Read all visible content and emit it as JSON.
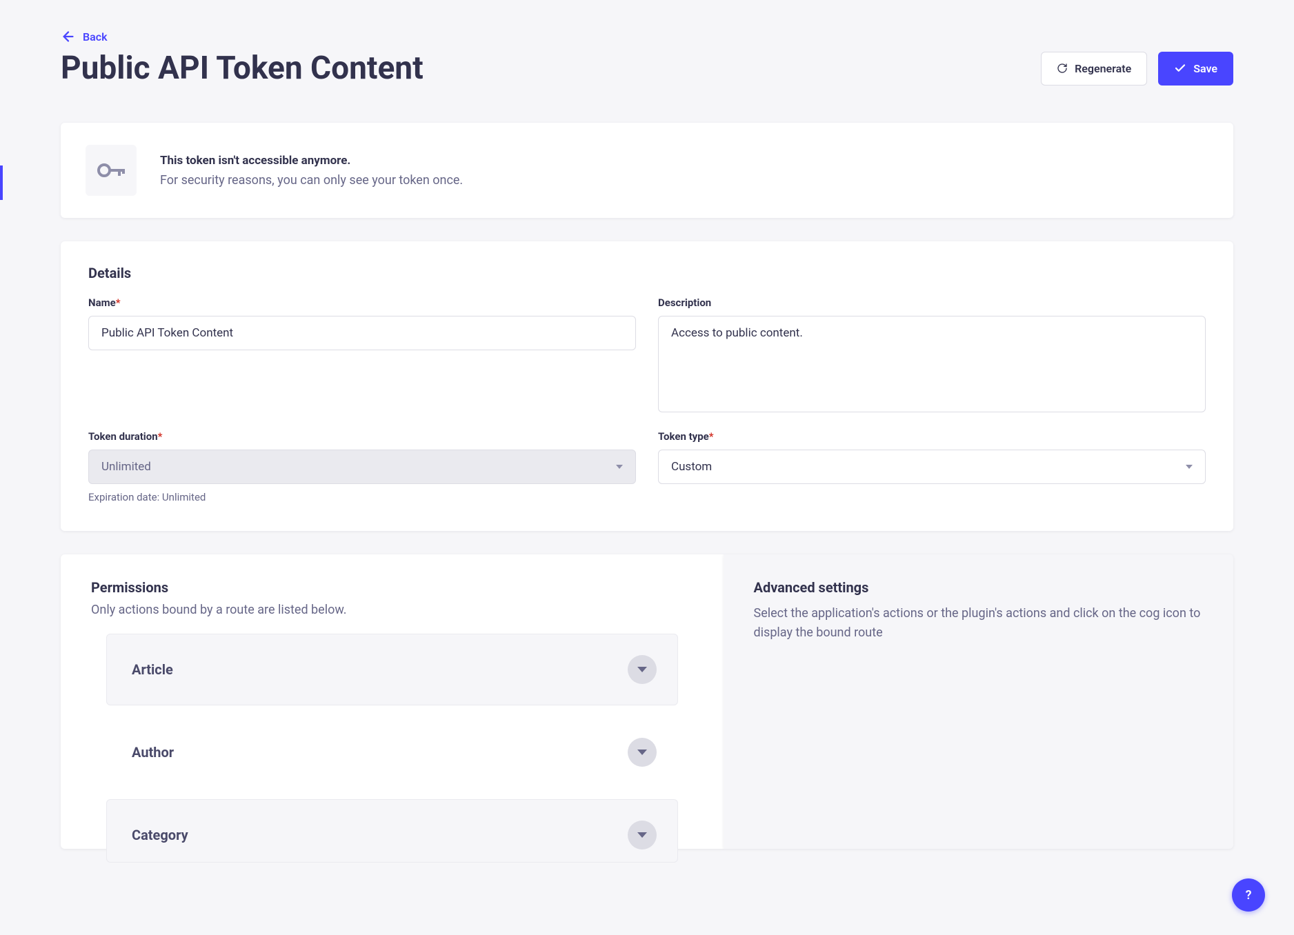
{
  "nav": {
    "back": "Back"
  },
  "header": {
    "title": "Public API Token Content",
    "regenerate": "Regenerate",
    "save": "Save"
  },
  "alert": {
    "title": "This token isn't accessible anymore.",
    "subtitle": "For security reasons, you can only see your token once."
  },
  "details": {
    "section_title": "Details",
    "name_label": "Name",
    "name_value": "Public API Token Content",
    "description_label": "Description",
    "description_value": "Access to public content.",
    "duration_label": "Token duration",
    "duration_value": "Unlimited",
    "expiration_hint": "Expiration date: Unlimited",
    "type_label": "Token type",
    "type_value": "Custom"
  },
  "permissions": {
    "title": "Permissions",
    "subtitle": "Only actions bound by a route are listed below.",
    "items": [
      {
        "label": "Article",
        "shaded": true
      },
      {
        "label": "Author",
        "shaded": false
      },
      {
        "label": "Category",
        "shaded": true
      }
    ]
  },
  "advanced": {
    "title": "Advanced settings",
    "subtitle": "Select the application's actions or the plugin's actions and click on the cog icon to display the bound route"
  },
  "help": {
    "label": "?"
  }
}
